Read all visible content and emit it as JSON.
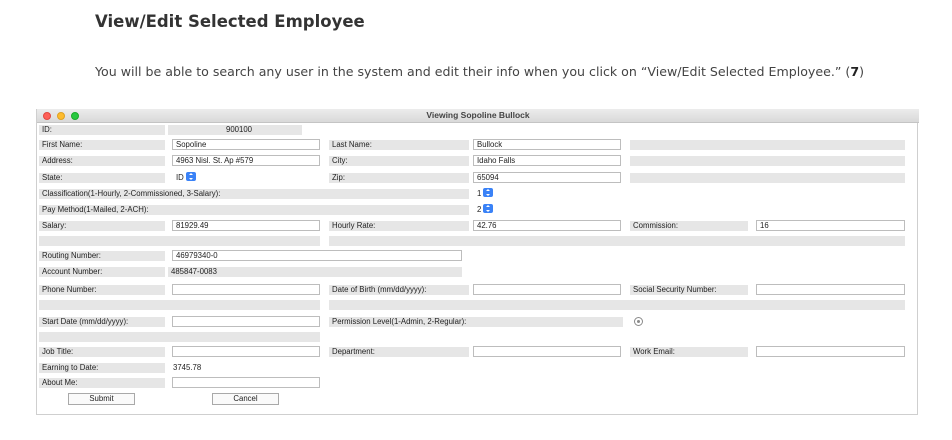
{
  "doc": {
    "heading": "View/Edit Selected Employee",
    "paragraph": "You will be able to search any user in the system and edit their info when you click on “View/Edit Selected Employee.” (",
    "paragraph_num": "7",
    "paragraph_end": ")"
  },
  "window": {
    "title": "Viewing Sopoline Bullock"
  },
  "form": {
    "id_label": "ID:",
    "id_value": "900100",
    "first_name_label": "First Name:",
    "first_name_value": "Sopoline",
    "last_name_label": "Last Name:",
    "last_name_value": "Bullock",
    "address_label": "Address:",
    "address_value": "4963 Nisl. St. Ap #579",
    "city_label": "City:",
    "city_value": "Idaho Falls",
    "state_label": "State:",
    "state_value": "ID",
    "zip_label": "Zip:",
    "zip_value": "65094",
    "classification_label": "Classification(1-Hourly, 2-Commissioned, 3-Salary):",
    "classification_value": "1",
    "pay_method_label": "Pay Method(1-Mailed, 2-ACH):",
    "pay_method_value": "2",
    "salary_label": "Salary:",
    "salary_value": "81929.49",
    "hourly_rate_label": "Hourly Rate:",
    "hourly_rate_value": "42.76",
    "commission_label": "Commission:",
    "commission_value": "16",
    "routing_label": "Routing Number:",
    "routing_value": "46979340-0",
    "account_label": "Account Number:",
    "account_value": "485847-0083",
    "phone_label": "Phone Number:",
    "phone_value": "",
    "dob_label": "Date of Birth (mm/dd/yyyy):",
    "dob_value": "",
    "ssn_label": "Social Security Number:",
    "ssn_value": "",
    "start_date_label": "Start Date (mm/dd/yyyy):",
    "start_date_value": "",
    "permission_label": "Permission Level(1-Admin, 2-Regular):",
    "job_title_label": "Job Title:",
    "job_title_value": "",
    "department_label": "Department:",
    "department_value": "",
    "work_email_label": "Work Email:",
    "work_email_value": "",
    "earning_label": "Earning to Date:",
    "earning_value": "3745.78",
    "about_label": "About Me:",
    "about_value": "",
    "submit_label": "Submit",
    "cancel_label": "Cancel"
  },
  "colors": {
    "close": "#fe5f57",
    "minimize": "#febc2e",
    "zoom": "#28c840",
    "stepper": "#3a82f7",
    "label_bg": "#e6e6e6"
  }
}
